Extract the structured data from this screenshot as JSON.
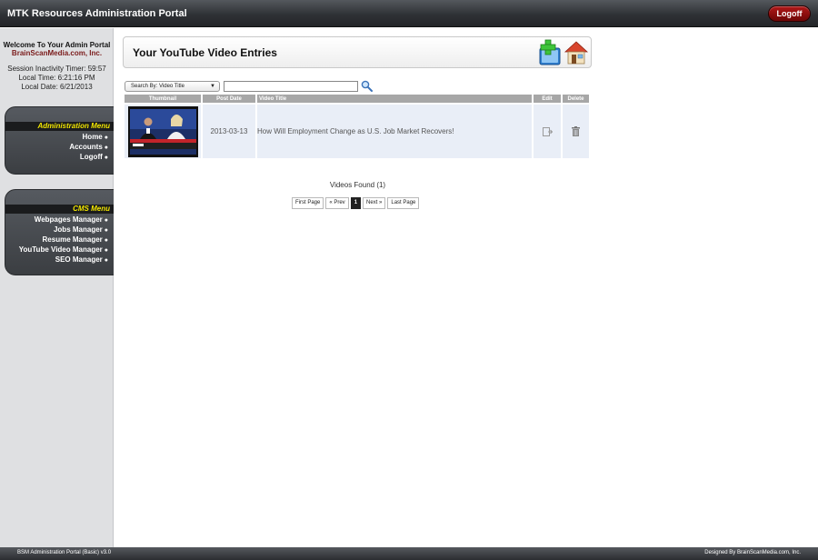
{
  "app": {
    "title": "MTK Resources Administration Portal",
    "logoff_label": "Logoff"
  },
  "sidebar": {
    "welcome_line1": "Welcome To Your Admin Portal",
    "welcome_line2": "BrainScanMedia.com, Inc.",
    "session_timer": "Session Inactivity Timer: 59:57",
    "local_time": "Local Time: 6:21:16 PM",
    "local_date": "Local Date: 6/21/2013",
    "admin_menu": {
      "title": "Administration Menu",
      "items": [
        {
          "label": "Home"
        },
        {
          "label": "Accounts"
        },
        {
          "label": "Logoff"
        }
      ]
    },
    "cms_menu": {
      "title": "CMS Menu",
      "items": [
        {
          "label": "Webpages Manager"
        },
        {
          "label": "Jobs Manager"
        },
        {
          "label": "Resume Manager"
        },
        {
          "label": "YouTube Video Manager"
        },
        {
          "label": "SEO Manager"
        }
      ]
    }
  },
  "main": {
    "page_title": "Your YouTube Video Entries",
    "search": {
      "select_label": "Search By: Video Title",
      "input_value": "",
      "input_placeholder": ""
    },
    "table": {
      "headers": {
        "thumbnail": "Thumbnail",
        "post_date": "Post Date",
        "video_title": "Video Title",
        "edit": "Edit",
        "delete": "Delete"
      },
      "rows": [
        {
          "post_date": "2013-03-13",
          "video_title": "How Will Employment Change as U.S. Job Market Recovers!"
        }
      ]
    },
    "videos_found": "Videos Found (1)",
    "pager": {
      "first": "First Page",
      "prev": "« Prev",
      "current": "1",
      "next": "Next »",
      "last": "Last Page"
    }
  },
  "footer": {
    "left": "BSM Administration Portal (Basic) v3.0",
    "right": "Designed By BrainScanMedia.com, Inc."
  },
  "colors": {
    "menu_title": "#f2e600",
    "logoff_button": "#8b0b0b",
    "table_header": "#a7a7a7",
    "row_bg": "#e9eef7"
  },
  "icons": [
    "add-folder-icon",
    "home-icon",
    "search-icon",
    "edit-icon",
    "trash-icon",
    "bullet-icon"
  ]
}
